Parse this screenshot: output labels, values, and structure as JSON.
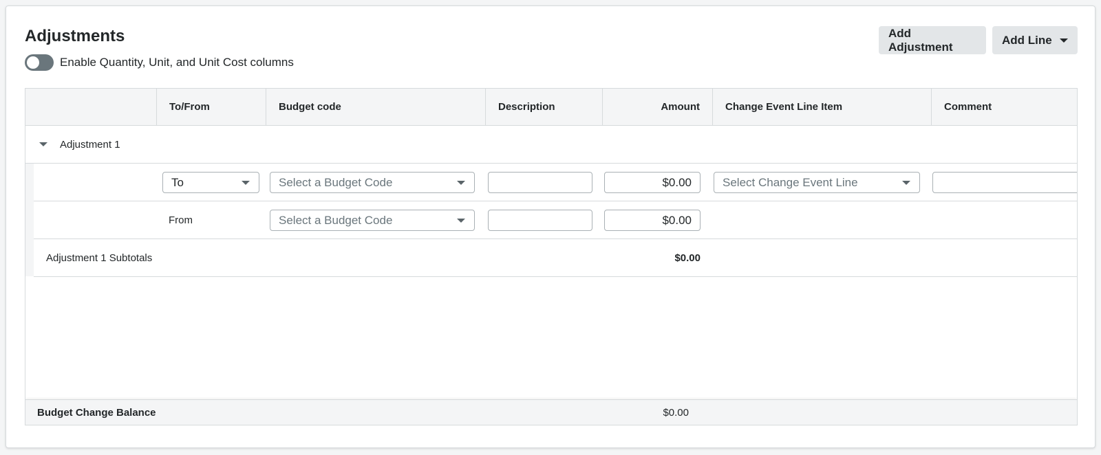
{
  "header": {
    "title": "Adjustments",
    "toggle_label": "Enable Quantity, Unit, and Unit Cost columns",
    "toggle_on": false,
    "add_adjustment_label": "Add Adjustment",
    "add_line_label": "Add Line"
  },
  "columns": {
    "blank": "",
    "to_from": "To/From",
    "budget_code": "Budget code",
    "description": "Description",
    "amount": "Amount",
    "change_event_line_item": "Change Event Line Item",
    "comment": "Comment"
  },
  "group": {
    "label": "Adjustment 1",
    "to_row": {
      "to_from_value": "To",
      "budget_code_placeholder": "Select a Budget Code",
      "description_value": "",
      "amount_value": "$0.00",
      "change_event_placeholder": "Select Change Event Line",
      "comment_value": ""
    },
    "from_row": {
      "to_from_label": "From",
      "budget_code_placeholder": "Select a Budget Code",
      "description_value": "",
      "amount_value": "$0.00"
    },
    "subtotal_label": "Adjustment 1 Subtotals",
    "subtotal_value": "$0.00"
  },
  "footer": {
    "label": "Budget Change Balance",
    "value": "$0.00"
  }
}
